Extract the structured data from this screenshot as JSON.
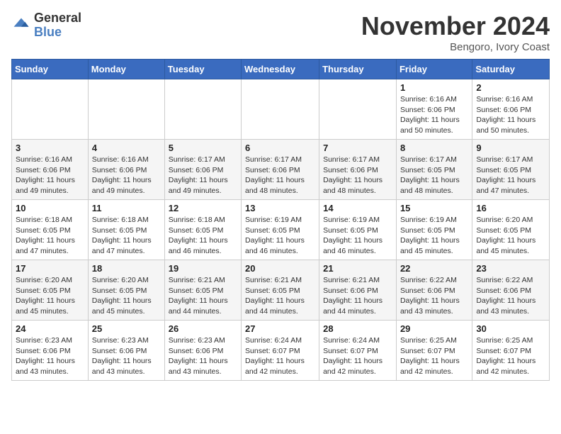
{
  "header": {
    "logo_general": "General",
    "logo_blue": "Blue",
    "month_title": "November 2024",
    "location": "Bengoro, Ivory Coast"
  },
  "days_of_week": [
    "Sunday",
    "Monday",
    "Tuesday",
    "Wednesday",
    "Thursday",
    "Friday",
    "Saturday"
  ],
  "weeks": [
    [
      {
        "day": "",
        "info": ""
      },
      {
        "day": "",
        "info": ""
      },
      {
        "day": "",
        "info": ""
      },
      {
        "day": "",
        "info": ""
      },
      {
        "day": "",
        "info": ""
      },
      {
        "day": "1",
        "info": "Sunrise: 6:16 AM\nSunset: 6:06 PM\nDaylight: 11 hours\nand 50 minutes."
      },
      {
        "day": "2",
        "info": "Sunrise: 6:16 AM\nSunset: 6:06 PM\nDaylight: 11 hours\nand 50 minutes."
      }
    ],
    [
      {
        "day": "3",
        "info": "Sunrise: 6:16 AM\nSunset: 6:06 PM\nDaylight: 11 hours\nand 49 minutes."
      },
      {
        "day": "4",
        "info": "Sunrise: 6:16 AM\nSunset: 6:06 PM\nDaylight: 11 hours\nand 49 minutes."
      },
      {
        "day": "5",
        "info": "Sunrise: 6:17 AM\nSunset: 6:06 PM\nDaylight: 11 hours\nand 49 minutes."
      },
      {
        "day": "6",
        "info": "Sunrise: 6:17 AM\nSunset: 6:06 PM\nDaylight: 11 hours\nand 48 minutes."
      },
      {
        "day": "7",
        "info": "Sunrise: 6:17 AM\nSunset: 6:06 PM\nDaylight: 11 hours\nand 48 minutes."
      },
      {
        "day": "8",
        "info": "Sunrise: 6:17 AM\nSunset: 6:05 PM\nDaylight: 11 hours\nand 48 minutes."
      },
      {
        "day": "9",
        "info": "Sunrise: 6:17 AM\nSunset: 6:05 PM\nDaylight: 11 hours\nand 47 minutes."
      }
    ],
    [
      {
        "day": "10",
        "info": "Sunrise: 6:18 AM\nSunset: 6:05 PM\nDaylight: 11 hours\nand 47 minutes."
      },
      {
        "day": "11",
        "info": "Sunrise: 6:18 AM\nSunset: 6:05 PM\nDaylight: 11 hours\nand 47 minutes."
      },
      {
        "day": "12",
        "info": "Sunrise: 6:18 AM\nSunset: 6:05 PM\nDaylight: 11 hours\nand 46 minutes."
      },
      {
        "day": "13",
        "info": "Sunrise: 6:19 AM\nSunset: 6:05 PM\nDaylight: 11 hours\nand 46 minutes."
      },
      {
        "day": "14",
        "info": "Sunrise: 6:19 AM\nSunset: 6:05 PM\nDaylight: 11 hours\nand 46 minutes."
      },
      {
        "day": "15",
        "info": "Sunrise: 6:19 AM\nSunset: 6:05 PM\nDaylight: 11 hours\nand 45 minutes."
      },
      {
        "day": "16",
        "info": "Sunrise: 6:20 AM\nSunset: 6:05 PM\nDaylight: 11 hours\nand 45 minutes."
      }
    ],
    [
      {
        "day": "17",
        "info": "Sunrise: 6:20 AM\nSunset: 6:05 PM\nDaylight: 11 hours\nand 45 minutes."
      },
      {
        "day": "18",
        "info": "Sunrise: 6:20 AM\nSunset: 6:05 PM\nDaylight: 11 hours\nand 45 minutes."
      },
      {
        "day": "19",
        "info": "Sunrise: 6:21 AM\nSunset: 6:05 PM\nDaylight: 11 hours\nand 44 minutes."
      },
      {
        "day": "20",
        "info": "Sunrise: 6:21 AM\nSunset: 6:05 PM\nDaylight: 11 hours\nand 44 minutes."
      },
      {
        "day": "21",
        "info": "Sunrise: 6:21 AM\nSunset: 6:06 PM\nDaylight: 11 hours\nand 44 minutes."
      },
      {
        "day": "22",
        "info": "Sunrise: 6:22 AM\nSunset: 6:06 PM\nDaylight: 11 hours\nand 43 minutes."
      },
      {
        "day": "23",
        "info": "Sunrise: 6:22 AM\nSunset: 6:06 PM\nDaylight: 11 hours\nand 43 minutes."
      }
    ],
    [
      {
        "day": "24",
        "info": "Sunrise: 6:23 AM\nSunset: 6:06 PM\nDaylight: 11 hours\nand 43 minutes."
      },
      {
        "day": "25",
        "info": "Sunrise: 6:23 AM\nSunset: 6:06 PM\nDaylight: 11 hours\nand 43 minutes."
      },
      {
        "day": "26",
        "info": "Sunrise: 6:23 AM\nSunset: 6:06 PM\nDaylight: 11 hours\nand 43 minutes."
      },
      {
        "day": "27",
        "info": "Sunrise: 6:24 AM\nSunset: 6:07 PM\nDaylight: 11 hours\nand 42 minutes."
      },
      {
        "day": "28",
        "info": "Sunrise: 6:24 AM\nSunset: 6:07 PM\nDaylight: 11 hours\nand 42 minutes."
      },
      {
        "day": "29",
        "info": "Sunrise: 6:25 AM\nSunset: 6:07 PM\nDaylight: 11 hours\nand 42 minutes."
      },
      {
        "day": "30",
        "info": "Sunrise: 6:25 AM\nSunset: 6:07 PM\nDaylight: 11 hours\nand 42 minutes."
      }
    ]
  ]
}
